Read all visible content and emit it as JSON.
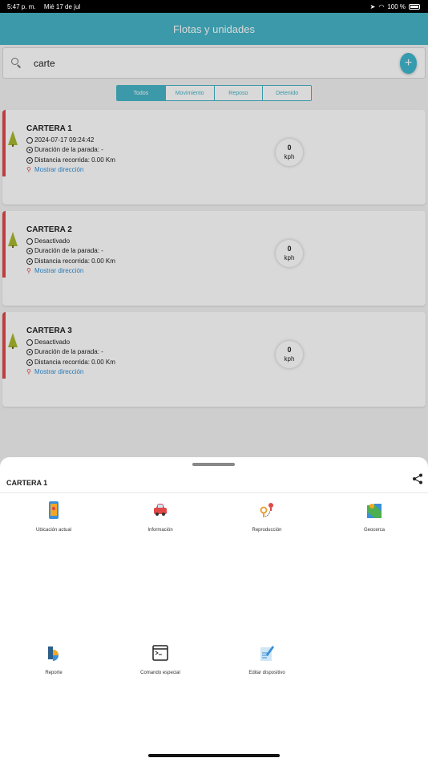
{
  "status_bar": {
    "time": "5:47 p. m.",
    "date": "Mié 17 de jul",
    "battery": "100 %"
  },
  "header": {
    "title": "Flotas y unidades"
  },
  "search": {
    "value": "carte"
  },
  "add_button": {
    "label": "+"
  },
  "filters": {
    "tabs": [
      "Todos",
      "Movimiento",
      "Reposo",
      "Detenido"
    ],
    "active": "Todos"
  },
  "units": [
    {
      "name": "CARTERA 1",
      "status": "2024-07-17 09:24:42",
      "stop_duration": "Duración de la parada: -",
      "distance": "Distancia recorrida: 0.00 Km",
      "address_link": "Mostrar dirección",
      "speed": "0",
      "speed_unit": "kph"
    },
    {
      "name": "CARTERA 2",
      "status": "Desactivado",
      "stop_duration": "Duración de la parada: -",
      "distance": "Distancia recorrida: 0.00 Km",
      "address_link": "Mostrar dirección",
      "speed": "0",
      "speed_unit": "kph"
    },
    {
      "name": "CARTERA 3",
      "status": "Desactivado",
      "stop_duration": "Duración de la parada: -",
      "distance": "Distancia recorrida: 0.00 Km",
      "address_link": "Mostrar dirección",
      "speed": "0",
      "speed_unit": "kph"
    }
  ],
  "sheet": {
    "title": "CARTERA 1",
    "actions": [
      {
        "label": "Ubicación actual",
        "icon": "phone-location-icon"
      },
      {
        "label": "Información",
        "icon": "car-icon"
      },
      {
        "label": "Reproducción",
        "icon": "route-pins-icon"
      },
      {
        "label": "Geocerca",
        "icon": "map-icon"
      },
      {
        "label": "Reporte",
        "icon": "report-chart-icon"
      },
      {
        "label": "Comando especial",
        "icon": "terminal-icon"
      },
      {
        "label": "Editar dispositivo",
        "icon": "edit-note-icon"
      }
    ]
  },
  "colors": {
    "header": "#46b4c7",
    "status_strip": "#e04848",
    "link": "#2f8fd8"
  }
}
